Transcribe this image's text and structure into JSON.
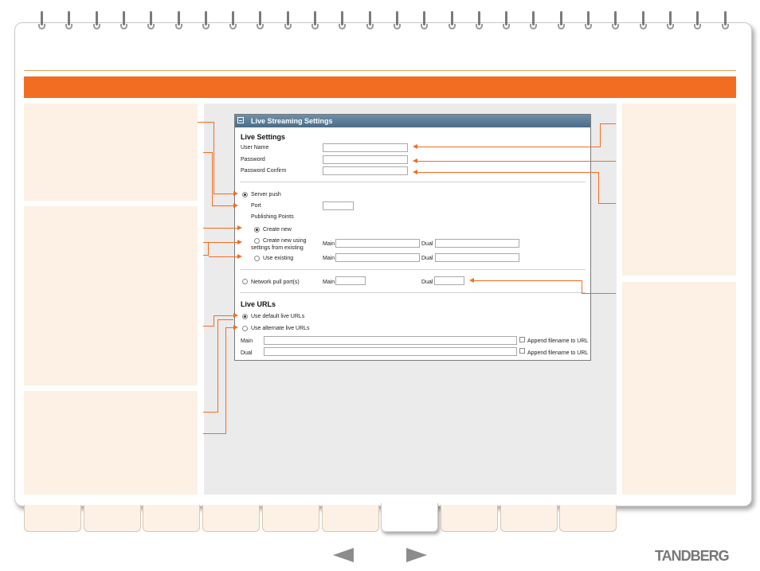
{
  "dialog": {
    "title": "Live Streaming Settings",
    "live_settings_heading": "Live Settings",
    "user_name_label": "User Name",
    "password_label": "Password",
    "password_confirm_label": "Password Confirm",
    "server_push_label": "Server push",
    "port_label": "Port",
    "publishing_points_label": "Publishing Points",
    "create_new_label": "Create new",
    "create_new_using_label_1": "Create new using",
    "create_new_using_label_2": "settings from existing",
    "use_existing_label": "Use existing",
    "main_label": "Main",
    "dual_label": "Dual",
    "network_pull_label": "Network pull port(s)",
    "live_urls_heading": "Live URLs",
    "use_default_label": "Use default live URLs",
    "use_alternate_label": "Use alternate live URLs",
    "append_label": "Append filename to URL"
  },
  "footer": {
    "logo": "TANDBERG"
  },
  "colors": {
    "accent": "#f26d21",
    "pane": "#fdf0e4",
    "title_bar": "#4a6c87"
  }
}
